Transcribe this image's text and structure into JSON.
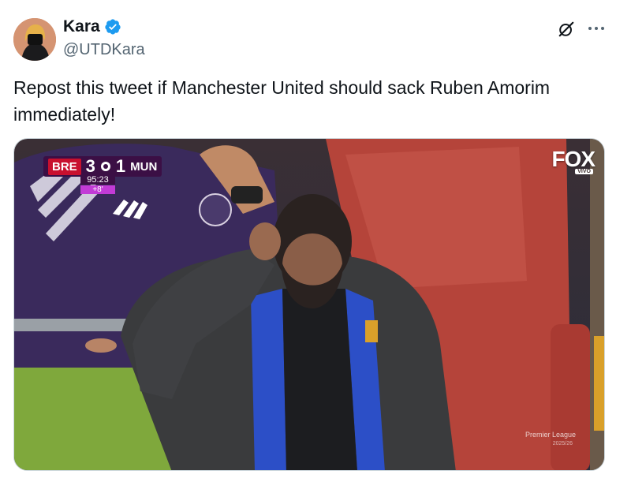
{
  "author": {
    "display_name": "Kara",
    "handle": "@UTDKara",
    "avatar_icon": "avatar-image",
    "verified_icon": "verified-badge-icon",
    "verified_color": "#1d9bf0"
  },
  "header_actions": {
    "grok_icon": "grok-icon",
    "more_icon": "more-dots-icon"
  },
  "tweet": {
    "text": "Repost this tweet if Manchester United should sack Ruben Amorim immediately!"
  },
  "media": {
    "scoreboard": {
      "home_team": "BRE",
      "home_score": "3",
      "away_score": "1",
      "away_team": "MUN",
      "clock": "95:23",
      "added_time": "+8'"
    },
    "broadcaster": "FOX",
    "broadcaster_sub": "VIVO",
    "league_watermark": "Premier League",
    "league_season": "2025/26"
  },
  "colors": {
    "text_primary": "#0f1419",
    "text_secondary": "#536471",
    "seat_red": "#b5443a",
    "jacket_dark": "#3a3b3d",
    "jacket_blue": "#2c4fc7",
    "pitch_green": "#7fa83c"
  }
}
